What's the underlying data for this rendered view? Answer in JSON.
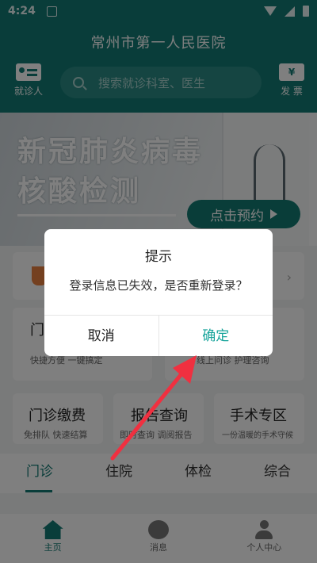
{
  "status_bar": {
    "time": "4:24"
  },
  "header": {
    "title": "常州市第一人民医院",
    "patient_label": "就诊人",
    "invoice_label": "发 票",
    "invoice_symbol": "¥",
    "search_placeholder": "搜索就诊科室、医生"
  },
  "banner": {
    "line1": "新冠肺炎病毒",
    "line2": "核酸检测",
    "button_label": "点击预约"
  },
  "cards": [
    {
      "title": "门诊",
      "subtitle": "快捷方便 一键搞定"
    },
    {
      "title": "",
      "subtitle": "线上问诊 护理咨询"
    },
    {
      "title": "门诊缴费",
      "subtitle": "免排队 快速结算"
    },
    {
      "title": "报告查询",
      "subtitle": "即时查询 调阅报告"
    },
    {
      "title": "手术专区",
      "subtitle": "一份温暖的手术守候"
    }
  ],
  "tabs": [
    "门诊",
    "住院",
    "体检",
    "综合"
  ],
  "bottom_nav": [
    {
      "label": "主页",
      "icon": "home-icon"
    },
    {
      "label": "消息",
      "icon": "message-icon"
    },
    {
      "label": "个人中心",
      "icon": "user-icon"
    }
  ],
  "dialog": {
    "title": "提示",
    "message": "登录信息已失效，是否重新登录？",
    "cancel_label": "取消",
    "confirm_label": "确定"
  },
  "colors": {
    "primary": "#127a74",
    "confirm": "#18a49b",
    "arrow": "#f03040"
  }
}
